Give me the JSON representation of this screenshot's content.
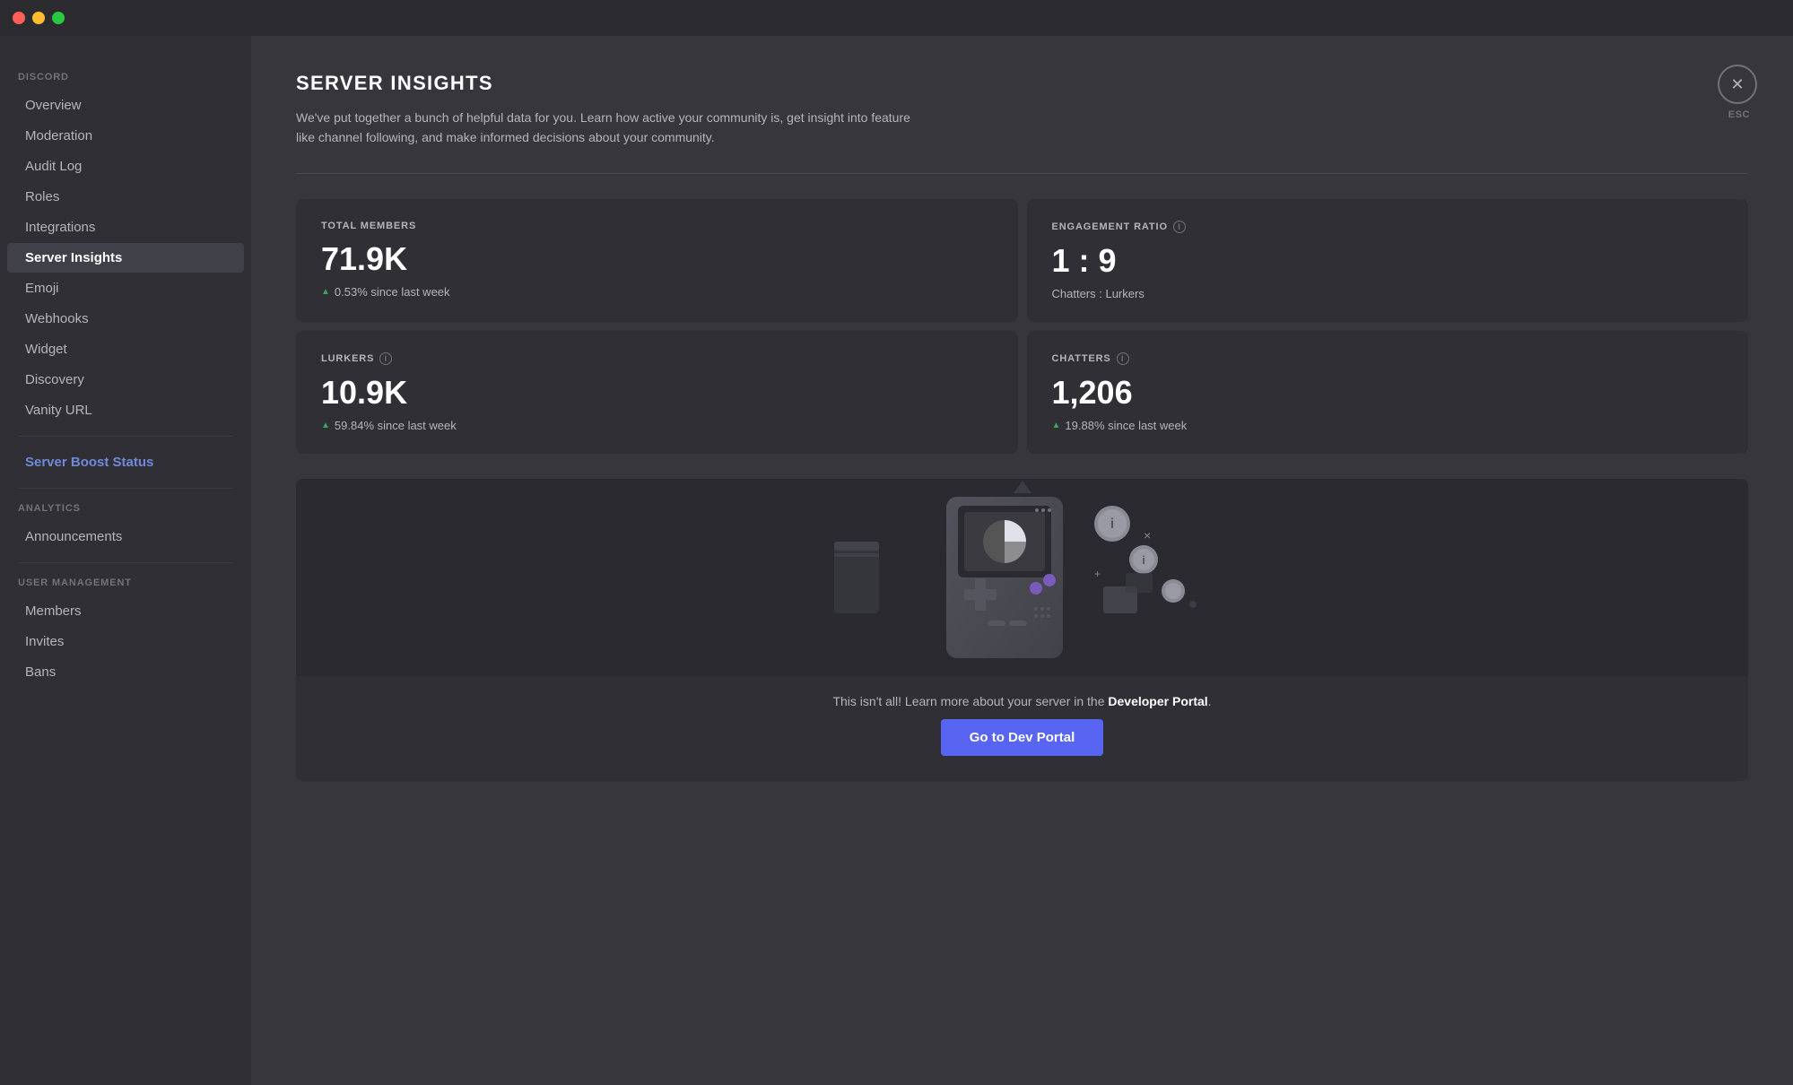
{
  "titlebar": {
    "dots": [
      "red",
      "yellow",
      "green"
    ]
  },
  "sidebar": {
    "discord_section_label": "DISCORD",
    "items": [
      {
        "id": "overview",
        "label": "Overview",
        "active": false
      },
      {
        "id": "moderation",
        "label": "Moderation",
        "active": false
      },
      {
        "id": "audit-log",
        "label": "Audit Log",
        "active": false
      },
      {
        "id": "roles",
        "label": "Roles",
        "active": false
      },
      {
        "id": "integrations",
        "label": "Integrations",
        "active": false
      },
      {
        "id": "server-insights",
        "label": "Server Insights",
        "active": true
      },
      {
        "id": "emoji",
        "label": "Emoji",
        "active": false
      },
      {
        "id": "webhooks",
        "label": "Webhooks",
        "active": false
      },
      {
        "id": "widget",
        "label": "Widget",
        "active": false
      },
      {
        "id": "discovery",
        "label": "Discovery",
        "active": false
      },
      {
        "id": "vanity-url",
        "label": "Vanity URL",
        "active": false
      }
    ],
    "boost_item": {
      "label": "Server Boost Status"
    },
    "analytics_section_label": "ANALYTICS",
    "analytics_items": [
      {
        "id": "announcements",
        "label": "Announcements"
      }
    ],
    "user_management_section_label": "USER MANAGEMENT",
    "user_management_items": [
      {
        "id": "members",
        "label": "Members"
      },
      {
        "id": "invites",
        "label": "Invites"
      },
      {
        "id": "bans",
        "label": "Bans"
      }
    ]
  },
  "main": {
    "page_title": "SERVER INSIGHTS",
    "close_button_label": "✕",
    "esc_label": "ESC",
    "description": "We've put together a bunch of helpful data for you. Learn how active your community is, get insight into feature like channel following, and make informed decisions about your community.",
    "stats": [
      {
        "id": "total-members",
        "label": "TOTAL MEMBERS",
        "has_info": false,
        "value": "71.9K",
        "change": "0.53% since last week",
        "change_positive": true,
        "icon": "person"
      },
      {
        "id": "engagement-ratio",
        "label": "ENGAGEMENT RATIO",
        "has_info": true,
        "value": "1 : 9",
        "sub_text": "Chatters : Lurkers",
        "icon": "scale"
      },
      {
        "id": "lurkers",
        "label": "LURKERS",
        "has_info": true,
        "value": "10.9K",
        "change": "59.84% since last week",
        "change_positive": true,
        "icon": "eye"
      },
      {
        "id": "chatters",
        "label": "CHATTERS",
        "has_info": true,
        "value": "1,206",
        "change": "19.88% since last week",
        "change_positive": true,
        "icon": "chat"
      }
    ],
    "dev_portal_text_prefix": "This isn't all! Learn more about your server in the ",
    "dev_portal_text_link": "Developer Portal",
    "dev_portal_text_suffix": ".",
    "dev_portal_button_label": "Go to Dev Portal"
  }
}
